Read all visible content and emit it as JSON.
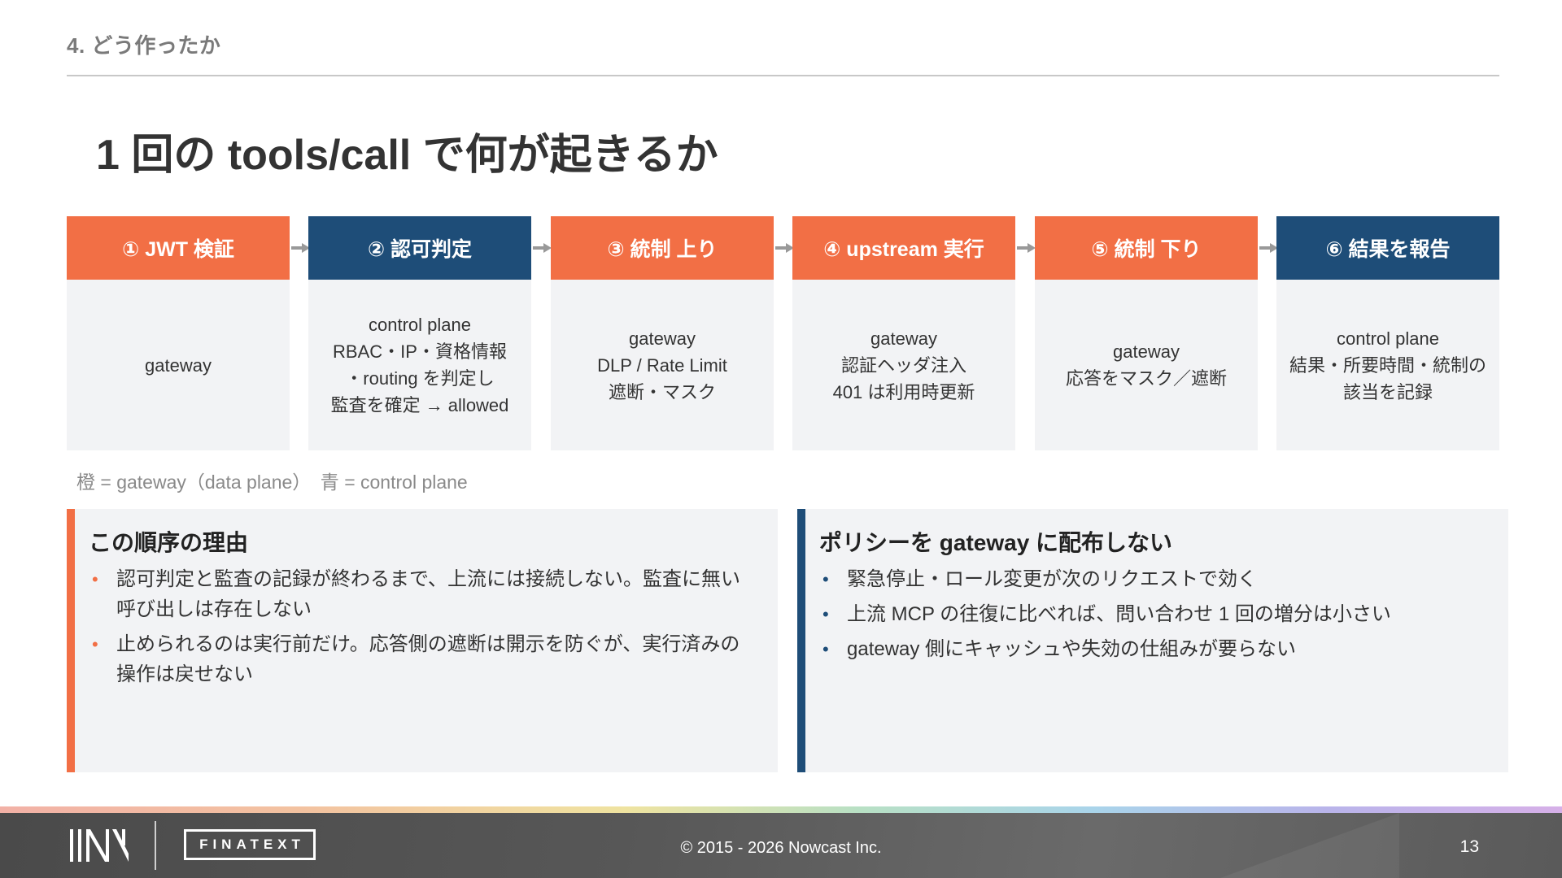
{
  "header": {
    "section": "4. どう作ったか",
    "title": "1 回の tools/call で何が起きるか"
  },
  "colors": {
    "orange": "#f26f45",
    "blue": "#1e4d78"
  },
  "steps": [
    {
      "label": "① JWT 検証",
      "color": "orange",
      "lines": [
        "gateway"
      ]
    },
    {
      "label": "② 認可判定",
      "color": "blue",
      "lines": [
        "control plane",
        "RBAC・IP・資格情報",
        "・routing を判定し",
        "監査を確定 → allowed"
      ]
    },
    {
      "label": "③ 統制 上り",
      "color": "orange",
      "lines": [
        "gateway",
        "DLP / Rate Limit",
        "遮断・マスク"
      ]
    },
    {
      "label": "④ upstream 実行",
      "color": "orange",
      "lines": [
        "gateway",
        "認証ヘッダ注入",
        "401 は利用時更新"
      ]
    },
    {
      "label": "⑤ 統制 下り",
      "color": "orange",
      "lines": [
        "gateway",
        "応答をマスク／遮断"
      ]
    },
    {
      "label": "⑥ 結果を報告",
      "color": "blue",
      "lines": [
        "control plane",
        "結果・所要時間・統制の",
        "該当を記録"
      ]
    }
  ],
  "legend": "橙 = gateway（data plane）　青 = control plane",
  "panels": {
    "left": {
      "title": "この順序の理由",
      "items": [
        "認可判定と監査の記録が終わるまで、上流には接続しない。監査に無い呼び出しは存在しない",
        "止められるのは実行前だけ。応答側の遮断は開示を防ぐが、実行済みの操作は戻せない"
      ]
    },
    "right": {
      "title": "ポリシーを gateway に配布しない",
      "items": [
        "緊急停止・ロール変更が次のリクエストで効く",
        "上流 MCP の往復に比べれば、問い合わせ 1 回の増分は小さい",
        "gateway 側にキャッシュや失効の仕組みが要らない"
      ]
    }
  },
  "footer": {
    "brand": "FINATEXT",
    "copyright": "© 2015 - 2026 Nowcast Inc.",
    "page": "13"
  }
}
